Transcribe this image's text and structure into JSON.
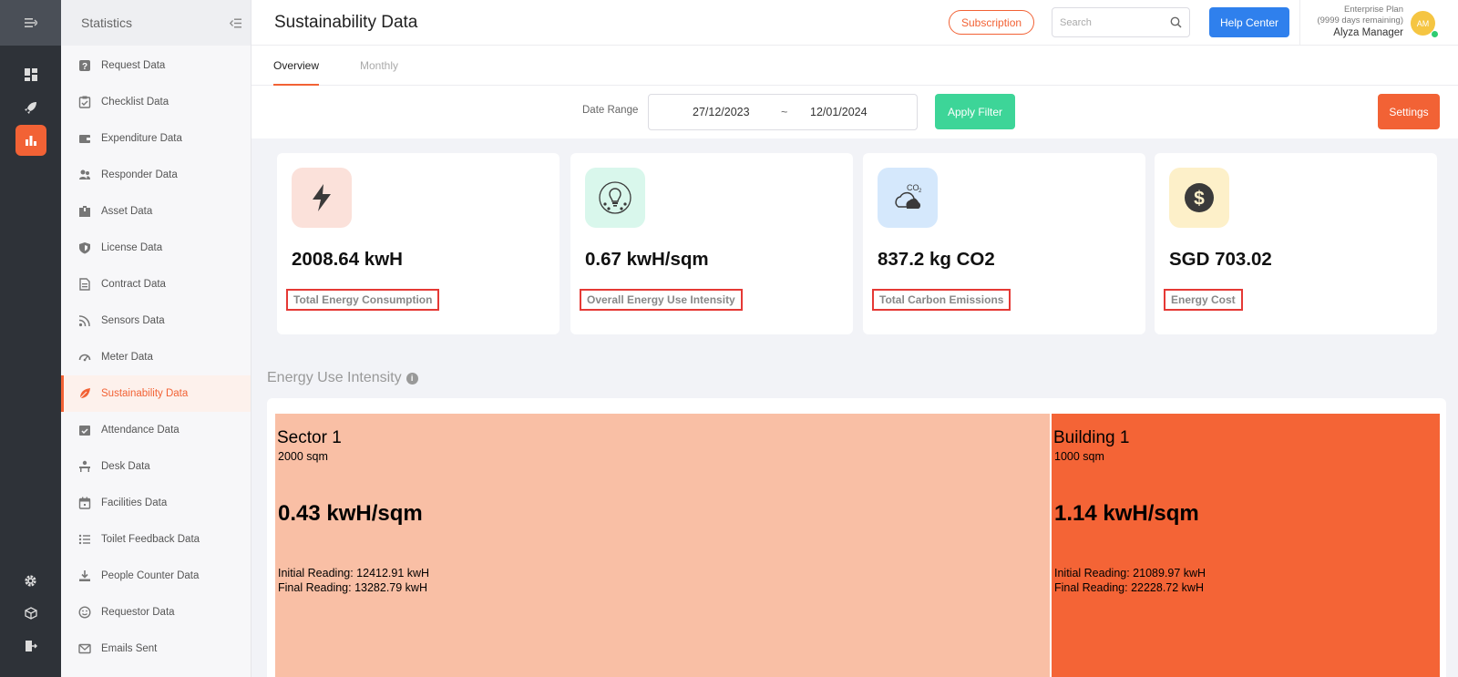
{
  "header": {
    "page_title": "Sustainability Data",
    "subscription_label": "Subscription",
    "search_placeholder": "Search",
    "help_label": "Help Center",
    "plan_name": "Enterprise Plan",
    "plan_days": "(9999 days remaining)",
    "user_name": "Alyza Manager",
    "avatar_initials": "AM"
  },
  "sidebar": {
    "title": "Statistics",
    "items": [
      {
        "label": "Request Data",
        "icon": "question-icon"
      },
      {
        "label": "Checklist Data",
        "icon": "checklist-icon"
      },
      {
        "label": "Expenditure Data",
        "icon": "wallet-icon"
      },
      {
        "label": "Responder Data",
        "icon": "users-icon"
      },
      {
        "label": "Asset Data",
        "icon": "box-icon"
      },
      {
        "label": "License Data",
        "icon": "shield-icon"
      },
      {
        "label": "Contract Data",
        "icon": "document-icon"
      },
      {
        "label": "Sensors Data",
        "icon": "signal-icon"
      },
      {
        "label": "Meter Data",
        "icon": "gauge-icon"
      },
      {
        "label": "Sustainability Data",
        "icon": "leaf-icon",
        "active": true
      },
      {
        "label": "Attendance Data",
        "icon": "calendar-check-icon"
      },
      {
        "label": "Desk Data",
        "icon": "desk-icon"
      },
      {
        "label": "Facilities Data",
        "icon": "calendar-icon"
      },
      {
        "label": "Toilet Feedback Data",
        "icon": "list-icon"
      },
      {
        "label": "People Counter Data",
        "icon": "download-icon"
      },
      {
        "label": "Requestor Data",
        "icon": "smiley-icon"
      },
      {
        "label": "Emails Sent",
        "icon": "mail-icon"
      }
    ]
  },
  "tabs": [
    {
      "label": "Overview",
      "active": true
    },
    {
      "label": "Monthly",
      "active": false
    }
  ],
  "filter": {
    "date_range_label": "Date Range",
    "start_date": "27/12/2023",
    "separator": "~",
    "end_date": "12/01/2024",
    "apply_label": "Apply Filter",
    "settings_label": "Settings"
  },
  "cards": [
    {
      "value": "2008.64 kwH",
      "label": "Total Energy Consumption",
      "icon": "lightning-icon",
      "bg": "#fbe1da"
    },
    {
      "value": "0.67 kwH/sqm",
      "label": "Overall Energy Use Intensity",
      "icon": "eco-bulb-icon",
      "bg": "#d9f7ec"
    },
    {
      "value": "837.2 kg CO2",
      "label": "Total Carbon Emissions",
      "icon": "co2-cloud-icon",
      "bg": "#d5e8fc"
    },
    {
      "value": "SGD 703.02",
      "label": "Energy Cost",
      "icon": "dollar-coin-icon",
      "bg": "#fdf0c9"
    }
  ],
  "eui": {
    "title": "Energy Use Intensity",
    "tiles": [
      {
        "name": "Sector 1",
        "area": "2000 sqm",
        "eui": "0.43 kwH/sqm",
        "initial": "Initial Reading: 12412.91 kwH",
        "final": "Final Reading: 13282.79 kwH",
        "color": "#f9bfa5"
      },
      {
        "name": "Building 1",
        "area": "1000 sqm",
        "eui": "1.14 kwH/sqm",
        "initial": "Initial Reading: 21089.97 kwH",
        "final": "Final Reading: 22228.72 kwH",
        "color": "#f46436"
      }
    ]
  },
  "colors": {
    "accent": "#f26235",
    "primary_blue": "#2f80ed",
    "success_green": "#3dd598",
    "rail_bg": "#2e3238"
  }
}
